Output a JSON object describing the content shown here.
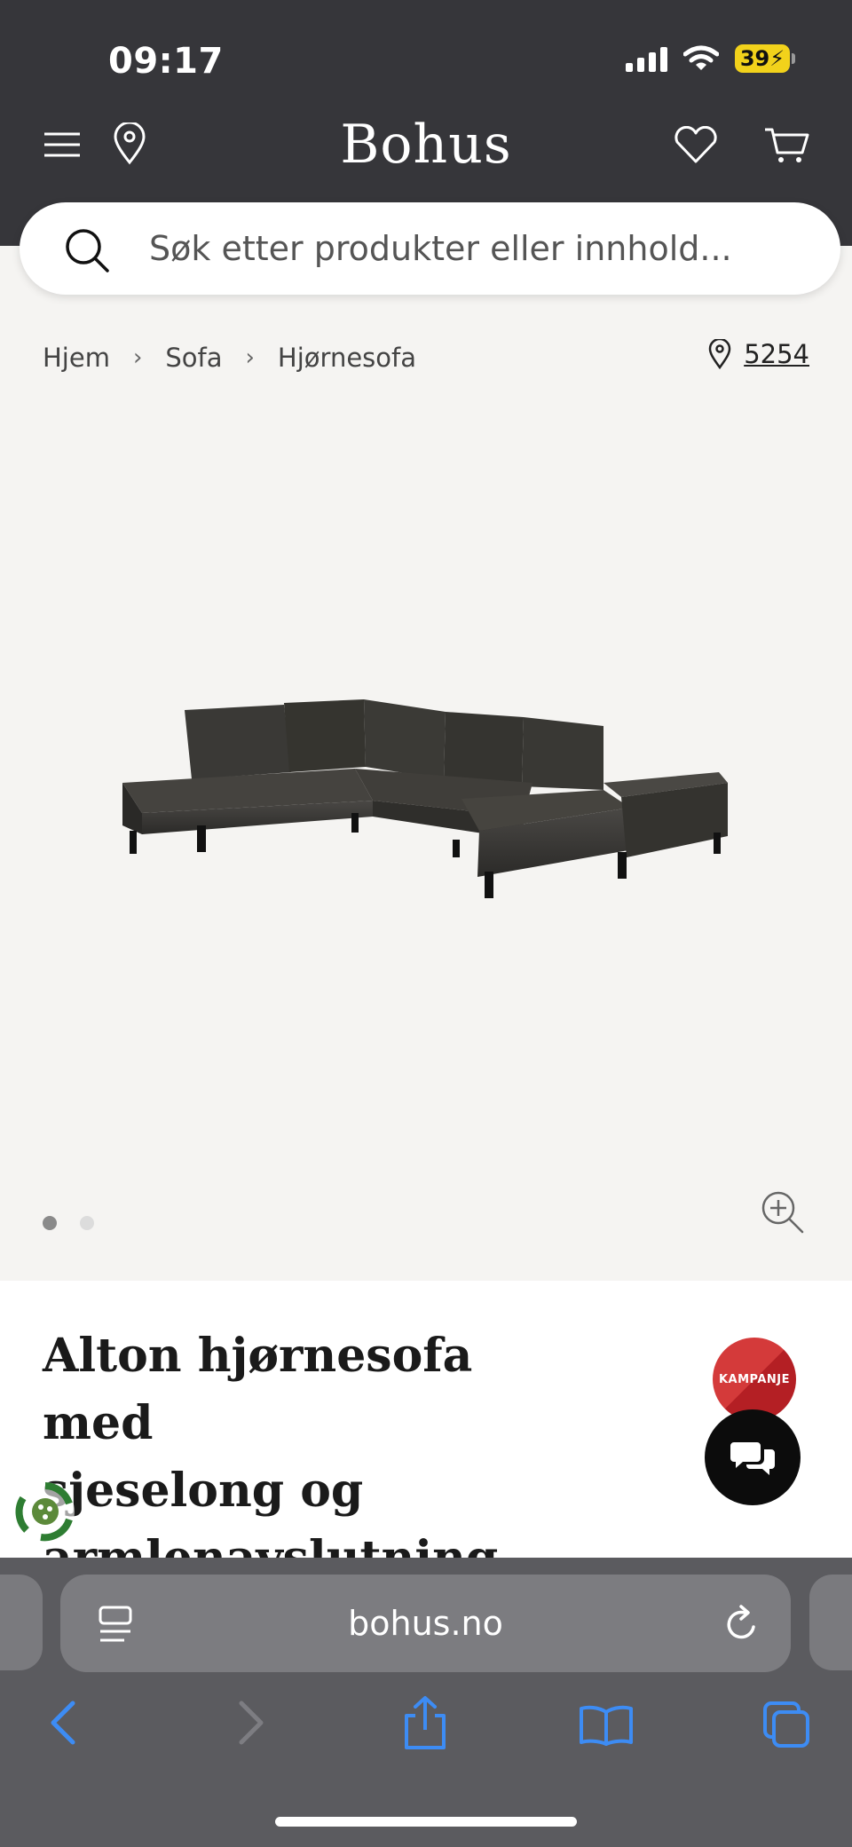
{
  "status_bar": {
    "time": "09:17",
    "battery": "39"
  },
  "header": {
    "brand": "Bohus"
  },
  "search": {
    "placeholder": "Søk etter produkter eller innhold..."
  },
  "breadcrumb": {
    "items": [
      "Hjem",
      "Sofa",
      "Hjørnesofa"
    ],
    "separator": "›"
  },
  "location": {
    "postal_code": "5254"
  },
  "gallery": {
    "image_count": 2,
    "active_index": 0
  },
  "product": {
    "title_line1": "Alton hjørnesofa med",
    "title_line2": "sjeselong og",
    "title_line3": "armlenavslutning",
    "badge": "KAMPANJE"
  },
  "browser": {
    "url": "bohus.no"
  },
  "colors": {
    "header_bg": "#36363a",
    "badge_red": "#d43a3a",
    "ios_blue": "#3d8cf4",
    "battery_yellow": "#f2d21b"
  }
}
